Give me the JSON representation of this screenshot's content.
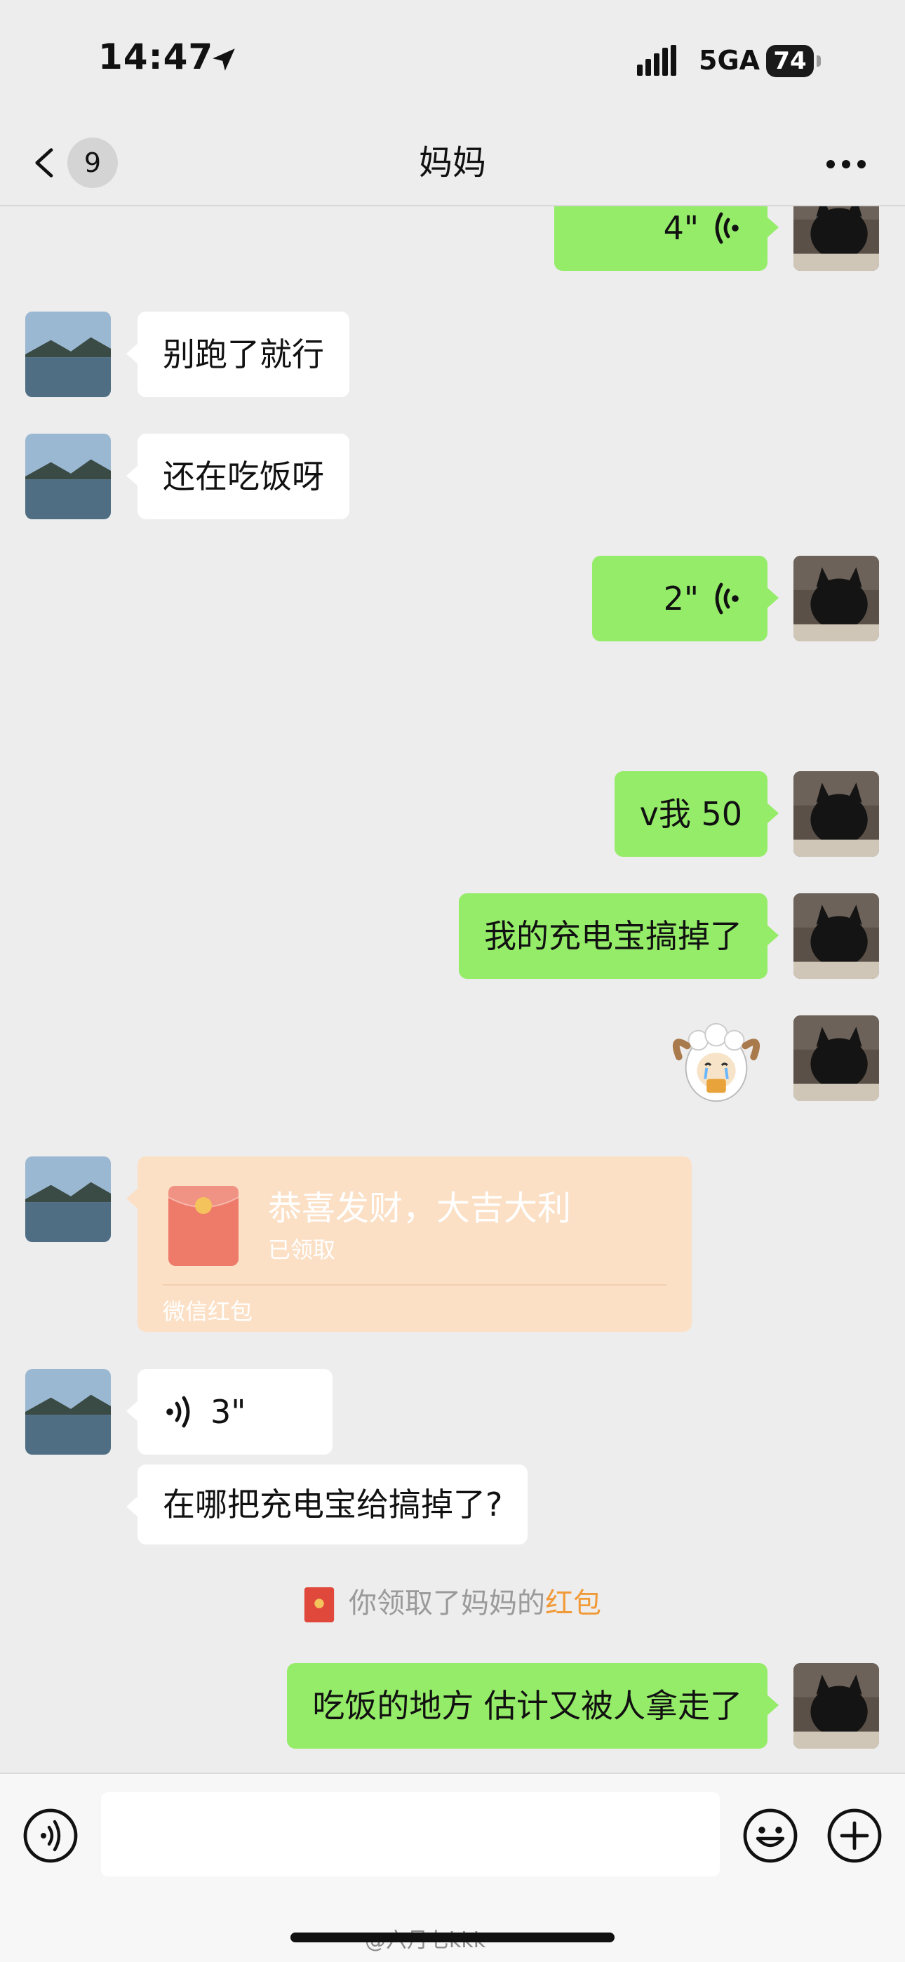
{
  "status_bar": {
    "time": "14:47",
    "network": "5GA",
    "battery": "74"
  },
  "nav": {
    "title": "妈妈",
    "unread_count": "9"
  },
  "messages": [
    {
      "type": "voice",
      "from": "me",
      "duration": "4\""
    },
    {
      "type": "text",
      "from": "contact",
      "text": "别跑了就行"
    },
    {
      "type": "text",
      "from": "contact",
      "text": "还在吃饭呀"
    },
    {
      "type": "voice",
      "from": "me",
      "duration": "2\""
    },
    {
      "type": "text",
      "from": "me",
      "text": "v我 50"
    },
    {
      "type": "text",
      "from": "me",
      "text": "我的充电宝搞掉了"
    },
    {
      "type": "sticker",
      "from": "me",
      "icon": "crying-sheep-sticker"
    },
    {
      "type": "red_packet",
      "from": "contact",
      "title": "恭喜发财，大吉大利",
      "status": "已领取",
      "footer": "微信红包"
    },
    {
      "type": "voice",
      "from": "contact",
      "duration": "3\""
    },
    {
      "type": "text",
      "from": "contact",
      "text": "在哪把充电宝给搞掉了?"
    },
    {
      "type": "system",
      "text_prefix": "你领取了妈妈的",
      "text_highlight": "红包"
    },
    {
      "type": "text",
      "from": "me",
      "text": "吃饭的地方 估计又被人拿走了"
    }
  ],
  "input": {
    "value": ""
  },
  "watermark": "@六月七kkk",
  "colors": {
    "outgoing_bubble": "#95ec69",
    "incoming_bubble": "#ffffff",
    "red_packet": "#fbe0c6",
    "highlight": "#f19a38"
  }
}
